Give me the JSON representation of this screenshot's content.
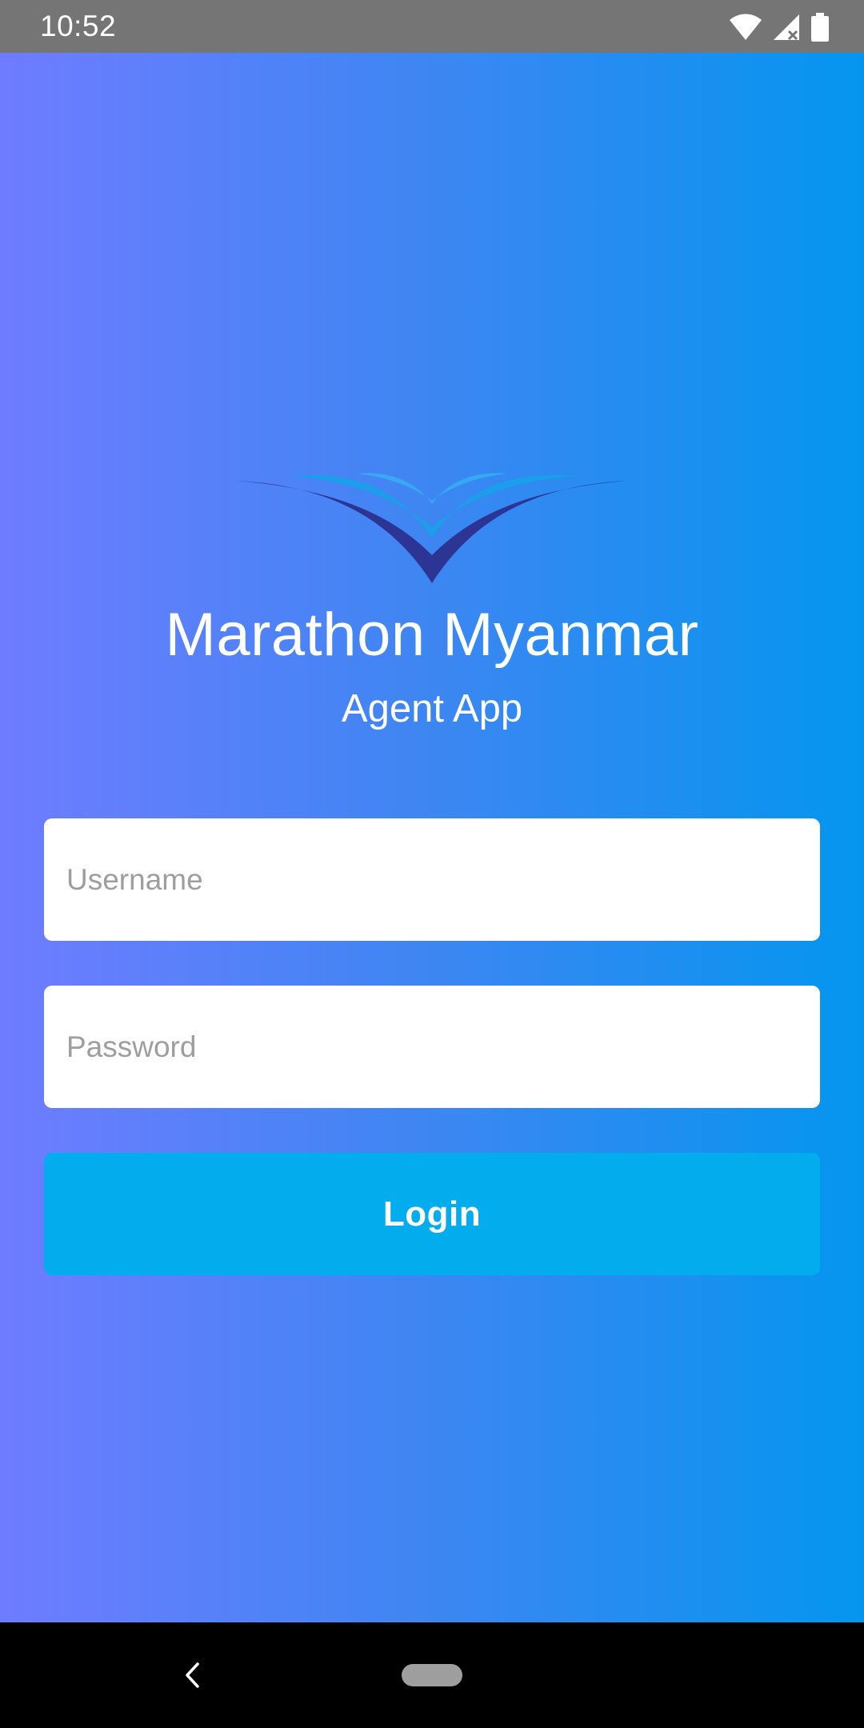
{
  "status_bar": {
    "time": "10:52",
    "icons": [
      "wifi-icon",
      "cell-signal-icon",
      "battery-icon"
    ]
  },
  "app": {
    "title": "Marathon Myanmar",
    "subtitle": "Agent App",
    "logo_icon": "wing-logo-icon"
  },
  "form": {
    "username_placeholder": "Username",
    "username_value": "",
    "password_placeholder": "Password",
    "password_value": "",
    "login_label": "Login"
  },
  "nav_bar": {
    "icons": [
      "back-icon",
      "home-pill-icon"
    ]
  },
  "colors": {
    "gradient_start": "#6f7cff",
    "gradient_end": "#0496ef",
    "login_button": "#03aced",
    "logo_dark": "#2c3494",
    "logo_light": "#1aa0ea",
    "status_bar": "#757575",
    "nav_bar": "#000000"
  }
}
